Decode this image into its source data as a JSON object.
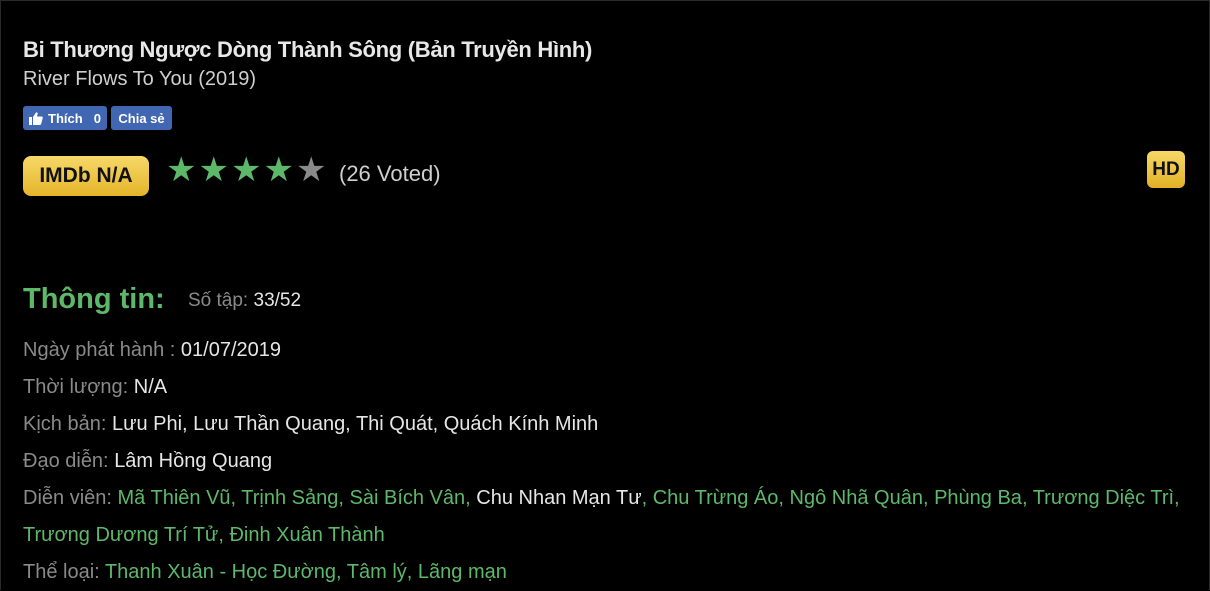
{
  "movie": {
    "title": "Bi Thương Ngược Dòng Thành Sông (Bản Truyền Hình)",
    "subtitle": "River Flows To You (2019)"
  },
  "social": {
    "like_label": "Thích",
    "like_count": "0",
    "share_label": "Chia sẻ"
  },
  "rating": {
    "imdb_label": "IMDb N/A",
    "stars_filled": 4,
    "stars_total": 5,
    "star_glyph": "★",
    "votes_text": "(26 Voted)"
  },
  "quality_badge": "HD",
  "info": {
    "heading": "Thông tin:",
    "episodes_label": "Số tập:",
    "episodes_value": "33/52",
    "release_label": "Ngày phát hành :",
    "release_value": "01/07/2019",
    "duration_label": "Thời lượng:",
    "duration_value": "N/A",
    "writers_label": "Kịch bản:",
    "writers_value": "Lưu Phi, Lưu Thần Quang, Thi Quát, Quách Kính Minh",
    "director_label": "Đạo diễn:",
    "director_value": "Lâm Hồng Quang",
    "cast_label": "Diễn viên:",
    "cast": [
      "Mã Thiên Vũ",
      "Trịnh Sảng",
      "Sài Bích Vân",
      "Chu Nhan Mạn Tư",
      "Chu Trừng Áo",
      "Ngô Nhã Quân",
      "Phùng Ba",
      "Trương Diệc Trì",
      "Trương Dương Trí Tử",
      "Đinh Xuân Thành"
    ],
    "genre_label": "Thể loại:",
    "genres": [
      "Thanh Xuân - Học Đường",
      "Tâm lý",
      "Lãng mạn"
    ]
  },
  "colors": {
    "background": "#000000",
    "accent_green": "#5db86a",
    "badge_gold": "#f0c94a",
    "facebook_blue": "#4267b2",
    "label_gray": "#8a8a8a"
  },
  "icons": {
    "like": "thumbs-up-icon",
    "star": "star-icon"
  }
}
